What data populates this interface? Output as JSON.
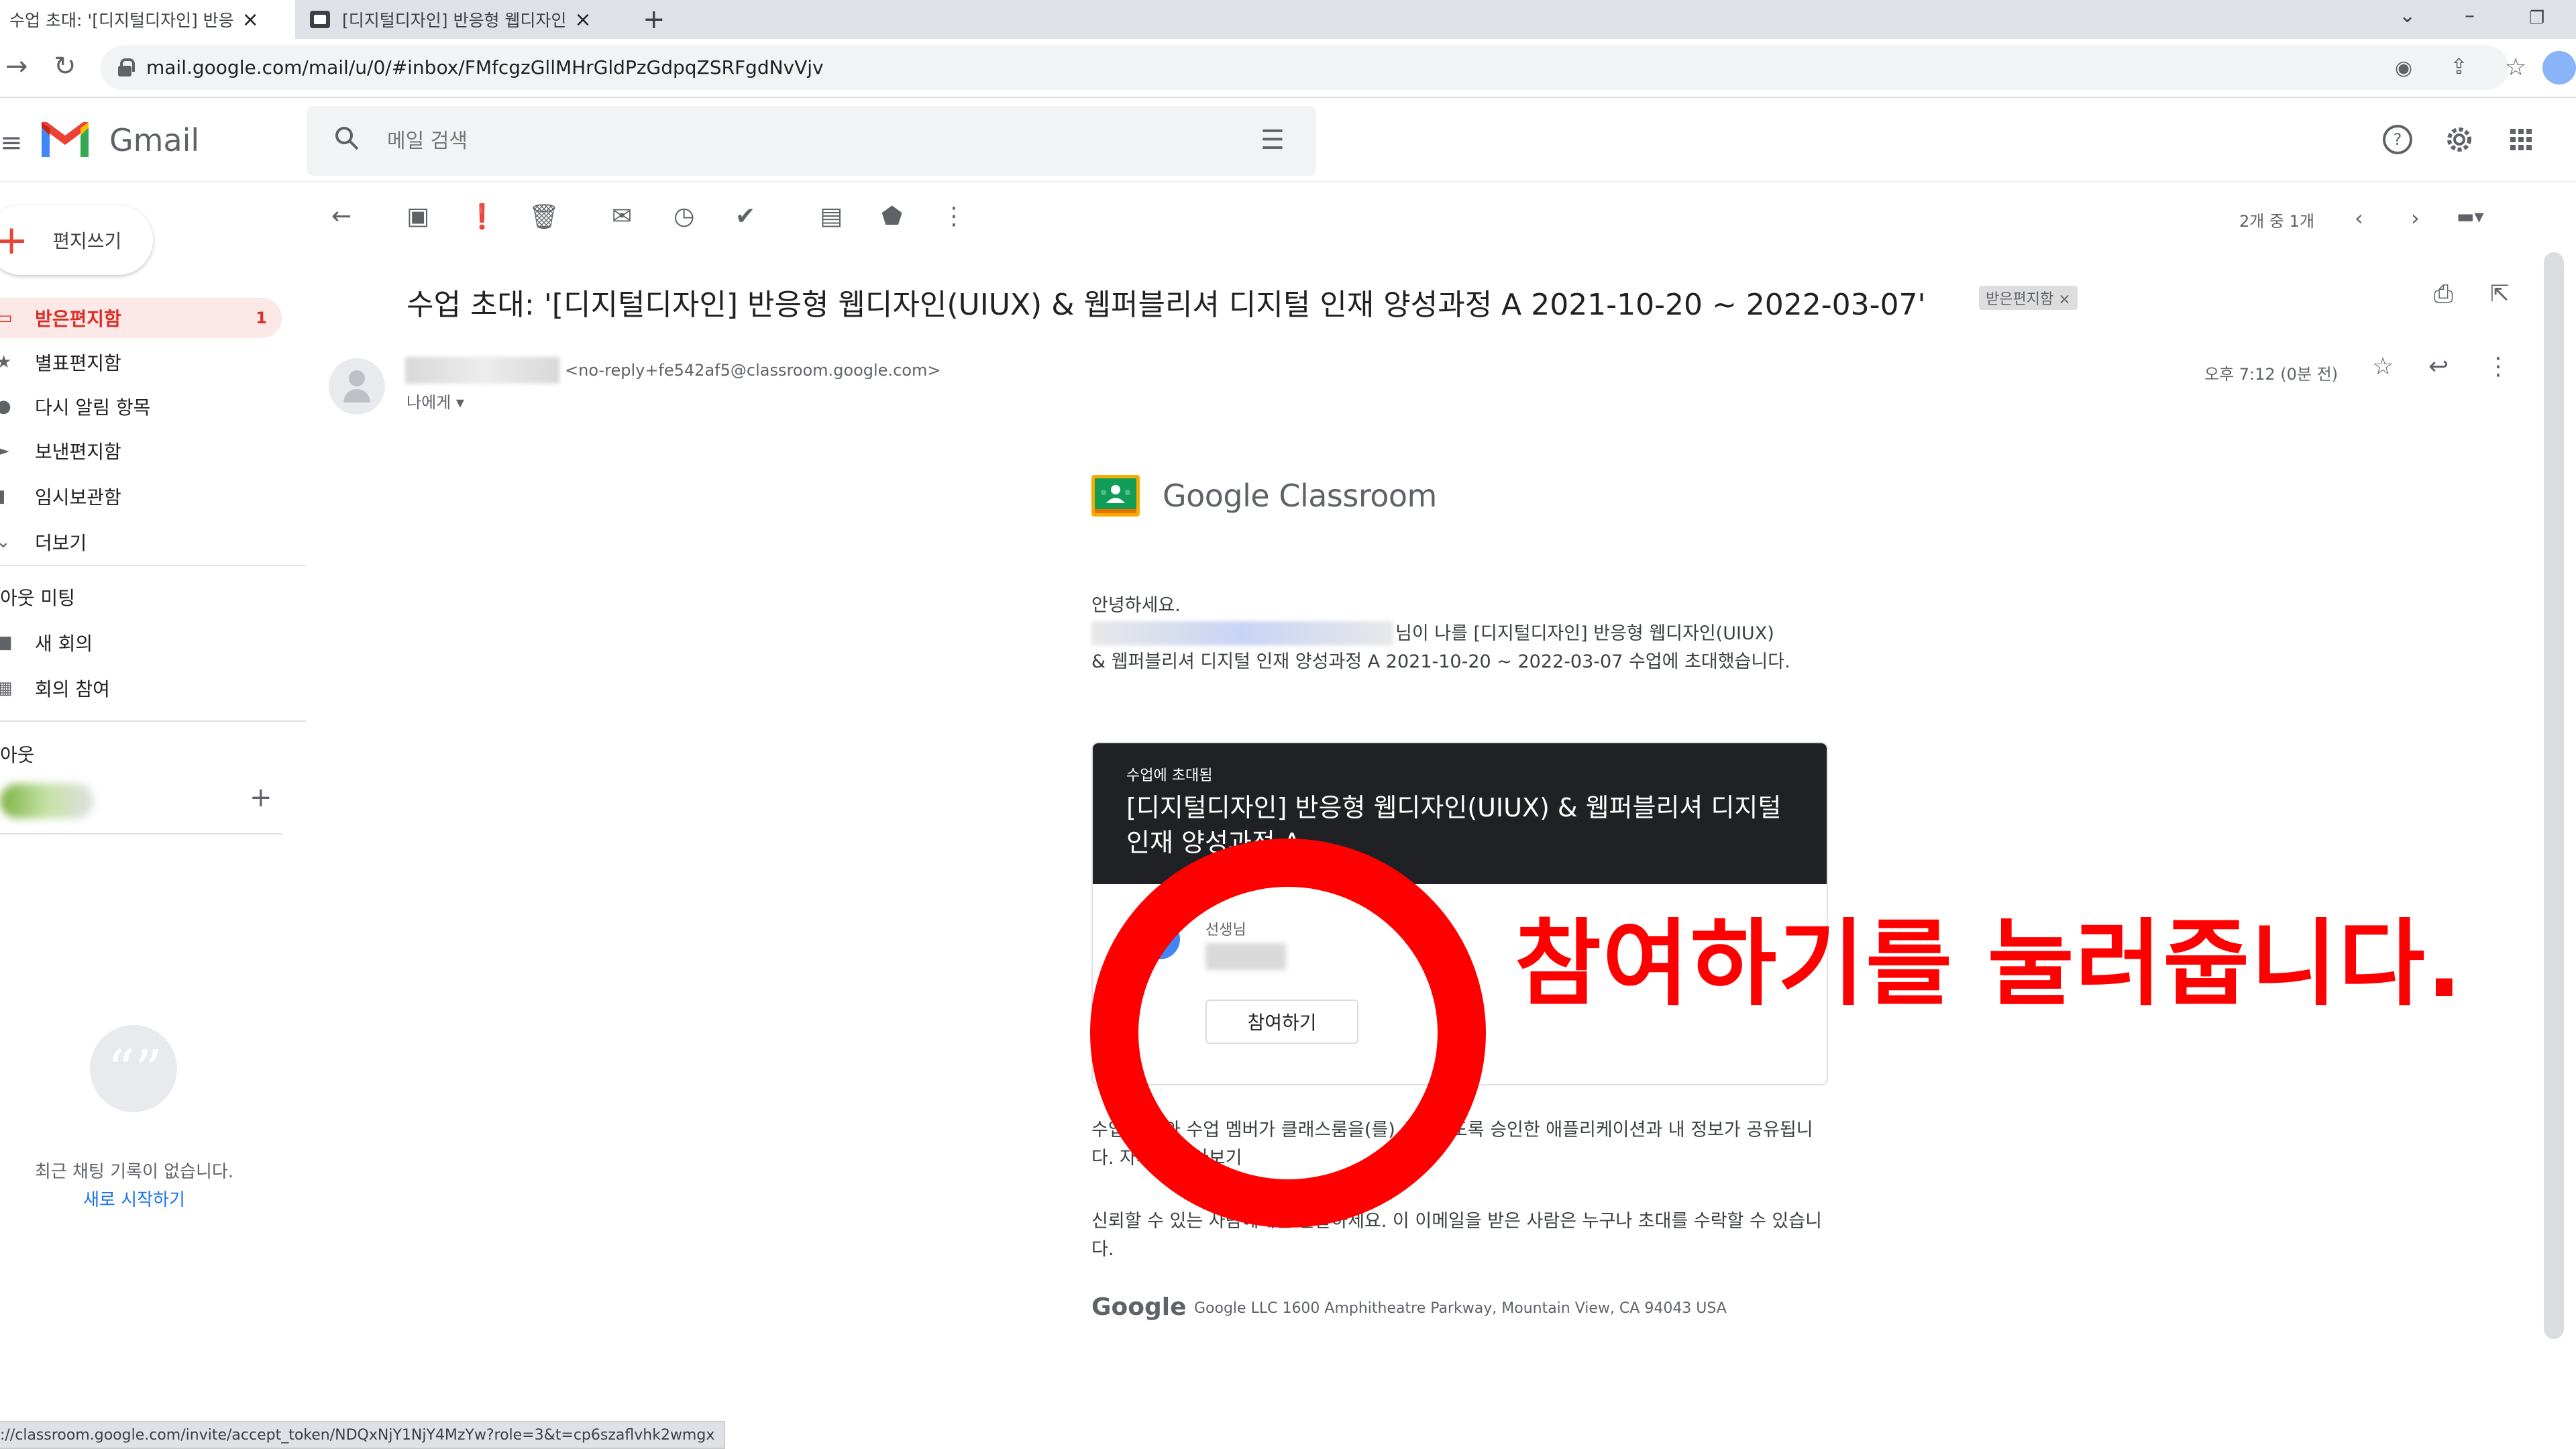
{
  "browser": {
    "tabs": [
      {
        "label": "수업 초대: '[디지털디자인] 반응",
        "close": "×"
      },
      {
        "label": "[디지털디자인] 반응형 웹디자인",
        "close": "×"
      }
    ],
    "new_tab": "+",
    "url": "mail.google.com/mail/u/0/#inbox/FMfcgzGllMHrGldPzGdpqZSRFgdNvVjv",
    "status_url": "://classroom.google.com/invite/accept_token/NDQxNjY1NjY4MzYw?role=3&t=cp6szaflvhk2wmgx"
  },
  "gmail": {
    "logo_text": "Gmail",
    "search_placeholder": "메일 검색",
    "compose_label": "편지쓰기",
    "nav": [
      {
        "label": "받은편지함",
        "count": "1"
      },
      {
        "label": "별표편지함"
      },
      {
        "label": "다시 알림 항목"
      },
      {
        "label": "보낸편지함"
      },
      {
        "label": "임시보관함"
      },
      {
        "label": "더보기"
      }
    ],
    "meet_header": "아웃 미팅",
    "meet_items": [
      "새 회의",
      "회의 참여"
    ],
    "hangouts_header": "아웃",
    "chat_empty": "최근 채팅 기록이 없습니다.",
    "chat_start": "새로 시작하기",
    "pager": "2개 중 1개"
  },
  "mail": {
    "subject": "수업 초대: '[디지털디자인] 반응형 웹디자인(UIUX) & 웹퍼블리셔 디지털 인재 양성과정 A 2021-10-20 ~ 2022-03-07'",
    "label_chip": "받은편지함 ×",
    "sender_email": "<no-reply+fe542af5@classroom.google.com>",
    "to": "나에게",
    "time": "오후 7:12 (0분 전)",
    "body": {
      "classroom_logo_text": "Google Classroom",
      "greeting": "안녕하세요.",
      "invite_line1": "님이 나를 [디지털디자인] 반응형 웹디자인(UIUX)",
      "invite_line2": "& 웹퍼블리셔 디지털 인재 양성과정 A 2021-10-20 ~ 2022-03-07 수업에 초대했습니다.",
      "card_kicker": "수업에 초대됨",
      "card_title": "[디지털디자인] 반응형 웹디자인(UIUX) & 웹퍼블리셔 디지털 인재 양성과정 A",
      "teacher_label": "선생님",
      "join_button": "참여하기",
      "footer1": "수업 멤버와 수업 멤버가 클래스룸을(를) 사용하도록 승인한 애플리케이션과 내 정보가 공유됩니다. 자세히 알아보기",
      "footer2": "신뢰할 수 있는 사람에게만 전달하세요. 이 이메일을 받은 사람은 누구나 초대를 수락할 수 있습니다.",
      "google_word": "Google",
      "google_address": "Google LLC 1600 Amphitheatre Parkway, Mountain View, CA 94043 USA"
    }
  },
  "annotation": {
    "text": "참여하기를 눌러줍니다.",
    "color": "#ff0000"
  },
  "icons": [
    "back-icon",
    "refresh-icon",
    "lock-icon",
    "eye-icon",
    "share-icon",
    "star-icon",
    "help-icon",
    "settings-icon",
    "apps-icon",
    "archive-icon",
    "report-spam-icon",
    "delete-icon",
    "mark-unread-icon",
    "snooze-icon",
    "add-task-icon",
    "move-icon",
    "label-icon",
    "more-icon",
    "print-icon",
    "open-new-window-icon",
    "reply-icon"
  ]
}
